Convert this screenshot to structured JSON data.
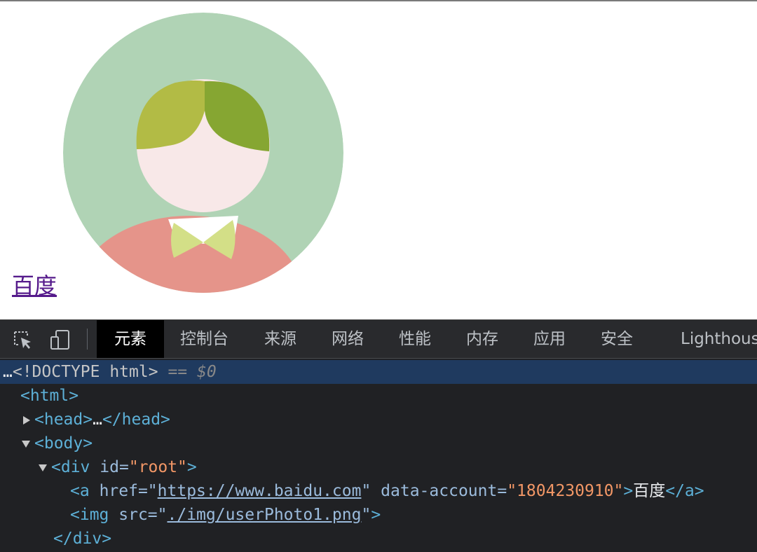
{
  "page": {
    "link_text": "百度"
  },
  "devtools": {
    "tabs": [
      {
        "label": "元素",
        "active": true
      },
      {
        "label": "控制台",
        "active": false
      },
      {
        "label": "来源",
        "active": false
      },
      {
        "label": "网络",
        "active": false
      },
      {
        "label": "性能",
        "active": false
      },
      {
        "label": "内存",
        "active": false
      },
      {
        "label": "应用",
        "active": false
      },
      {
        "label": "安全",
        "active": false
      },
      {
        "label": "Lighthouse",
        "active": false
      }
    ],
    "tree": {
      "ellipsis": "…",
      "doctype": "<!DOCTYPE html>",
      "selected_marker": "== $0",
      "html_open": "<html>",
      "head_open": "<head>",
      "head_collapsed": "…",
      "head_close": "</head>",
      "body_open": "<body>",
      "div_tag_open": "<div",
      "div_attr": "id",
      "div_attr_value": "\"root\"",
      "tag_gt": ">",
      "a_tag_open": "<a",
      "a_href_attr": "href",
      "a_href_value": "https://www.baidu.com",
      "a_data_attr": "data-account",
      "a_data_value": "\"1804230910\"",
      "a_text": "百度",
      "a_close": "</a>",
      "img_tag_open": "<img",
      "img_src_attr": "src",
      "img_src_value": "./img/userPhoto1.png",
      "div_close": "</div>",
      "eq_quote": "=\"",
      "quote": "\""
    }
  },
  "colors": {
    "avatar_bg": "#b0d3b5",
    "hair_left": "#b2bb45",
    "hair_right": "#86a632",
    "face": "#f8e8e8",
    "body": "#e5948a",
    "bowtie": "#d3df87",
    "selected_row": "#1f3a5f"
  }
}
